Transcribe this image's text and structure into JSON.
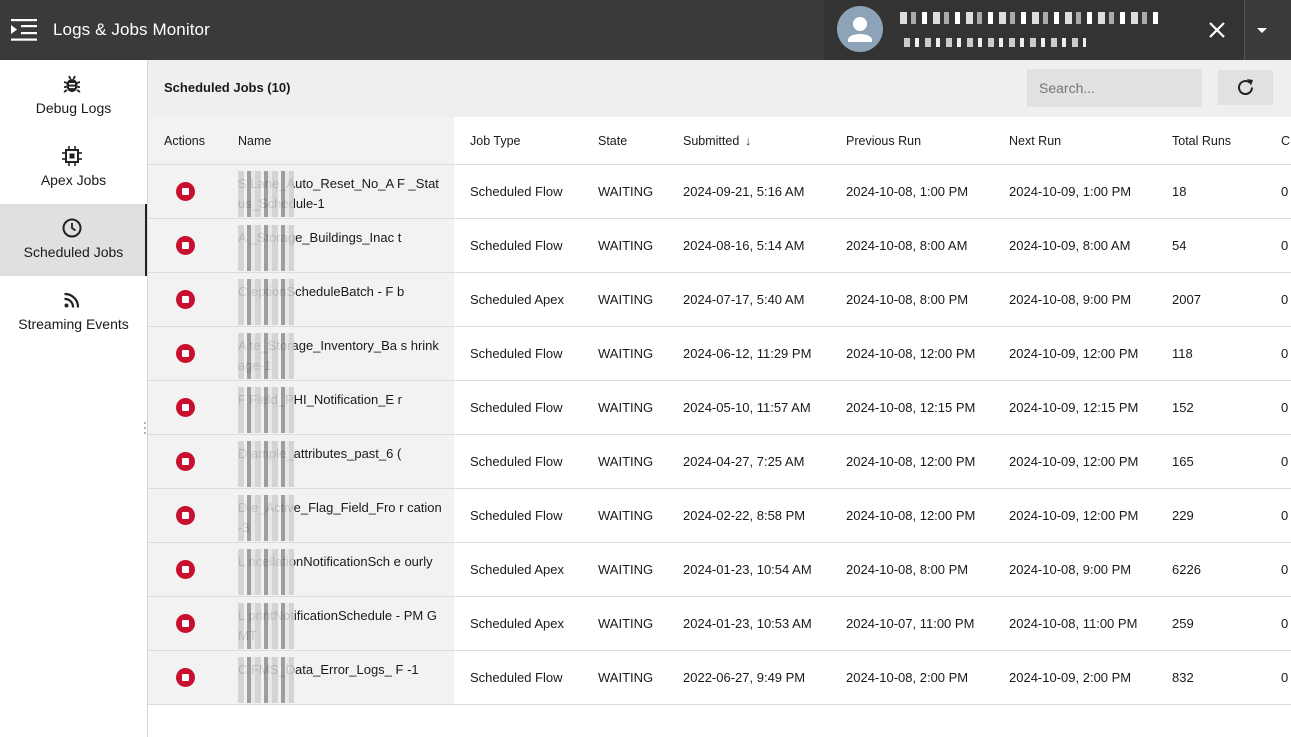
{
  "app": {
    "title": "Logs & Jobs Monitor"
  },
  "header": {
    "colors": {
      "bar": "#3a3a3a",
      "user_area": "#333333",
      "avatar_bg": "#8da3b7"
    },
    "icons": {
      "menu": "menu-collapse-icon",
      "avatar": "user-icon",
      "close": "close-icon",
      "dropdown": "caret-down-icon"
    }
  },
  "sidebar": {
    "items": [
      {
        "label": "Debug Logs",
        "icon": "bug-icon",
        "active": false
      },
      {
        "label": "Apex Jobs",
        "icon": "chip-icon",
        "active": false
      },
      {
        "label": "Scheduled Jobs",
        "icon": "clock-icon",
        "active": true
      },
      {
        "label": "Streaming Events",
        "icon": "rss-icon",
        "active": false
      }
    ]
  },
  "main": {
    "title": "Scheduled Jobs (10)",
    "search": {
      "placeholder": "Search...",
      "value": ""
    },
    "refresh_icon": "refresh-icon",
    "stop_color": "#c8102e"
  },
  "table": {
    "columns": {
      "actions": "Actions",
      "name": "Name",
      "job_type": "Job Type",
      "state": "State",
      "submitted": "Submitted",
      "submitted_sort": "↓",
      "previous_run": "Previous Run",
      "next_run": "Next Run",
      "total_runs": "Total Runs",
      "cut": "C"
    },
    "rows": [
      {
        "name": "S Lane_Auto_Reset_No_A F _Status_Schedule-1",
        "job_type": "Scheduled Flow",
        "state": "WAITING",
        "submitted": "2024-09-21, 5:16 AM",
        "previous_run": "2024-10-08, 1:00 PM",
        "next_run": "2024-10-09, 1:00 PM",
        "total_runs": "18",
        "cut": "0"
      },
      {
        "name": "A _Storage_Buildings_Inac t",
        "job_type": "Scheduled Flow",
        "state": "WAITING",
        "submitted": "2024-08-16, 5:14 AM",
        "previous_run": "2024-10-08, 8:00 AM",
        "next_run": "2024-10-09, 8:00 AM",
        "total_runs": "54",
        "cut": "0"
      },
      {
        "name": "C eptionScheduleBatch - F b",
        "job_type": "Scheduled Apex",
        "state": "WAITING",
        "submitted": "2024-07-17, 5:40 AM",
        "previous_run": "2024-10-08, 8:00 PM",
        "next_run": "2024-10-08, 9:00 PM",
        "total_runs": "2007",
        "cut": "0"
      },
      {
        "name": "A te_Storage_Inventory_Ba s hrinkage-1",
        "job_type": "Scheduled Flow",
        "state": "WAITING",
        "submitted": "2024-06-12, 11:29 PM",
        "previous_run": "2024-10-08, 12:00 PM",
        "next_run": "2024-10-09, 12:00 PM",
        "total_runs": "118",
        "cut": "0"
      },
      {
        "name": "F Field_PHI_Notification_E r",
        "job_type": "Scheduled Flow",
        "state": "WAITING",
        "submitted": "2024-05-10, 11:57 AM",
        "previous_run": "2024-10-08, 12:15 PM",
        "next_run": "2024-10-09, 12:15 PM",
        "total_runs": "152",
        "cut": "0"
      },
      {
        "name": "D ample_attributes_past_6 (",
        "job_type": "Scheduled Flow",
        "state": "WAITING",
        "submitted": "2024-04-27, 7:25 AM",
        "previous_run": "2024-10-08, 12:00 PM",
        "next_run": "2024-10-09, 12:00 PM",
        "total_runs": "165",
        "cut": "0"
      },
      {
        "name": "D e_Active_Flag_Field_Fro r cation-3",
        "job_type": "Scheduled Flow",
        "state": "WAITING",
        "submitted": "2024-02-22, 8:58 PM",
        "previous_run": "2024-10-08, 12:00 PM",
        "next_run": "2024-10-09, 12:00 PM",
        "total_runs": "229",
        "cut": "0"
      },
      {
        "name": "L ncellationNotificationSch e ourly",
        "job_type": "Scheduled Apex",
        "state": "WAITING",
        "submitted": "2024-01-23, 10:54 AM",
        "previous_run": "2024-10-08, 8:00 PM",
        "next_run": "2024-10-08, 9:00 PM",
        "total_runs": "6226",
        "cut": "0"
      },
      {
        "name": "L printNotificationSchedule - PM GMT",
        "job_type": "Scheduled Apex",
        "state": "WAITING",
        "submitted": "2024-01-23, 10:53 AM",
        "previous_run": "2024-10-07, 11:00 PM",
        "next_run": "2024-10-08, 11:00 PM",
        "total_runs": "259",
        "cut": "0"
      },
      {
        "name": "C FMS_Data_Error_Logs_ F -1",
        "job_type": "Scheduled Flow",
        "state": "WAITING",
        "submitted": "2022-06-27, 9:49 PM",
        "previous_run": "2024-10-08, 2:00 PM",
        "next_run": "2024-10-09, 2:00 PM",
        "total_runs": "832",
        "cut": "0"
      }
    ]
  }
}
